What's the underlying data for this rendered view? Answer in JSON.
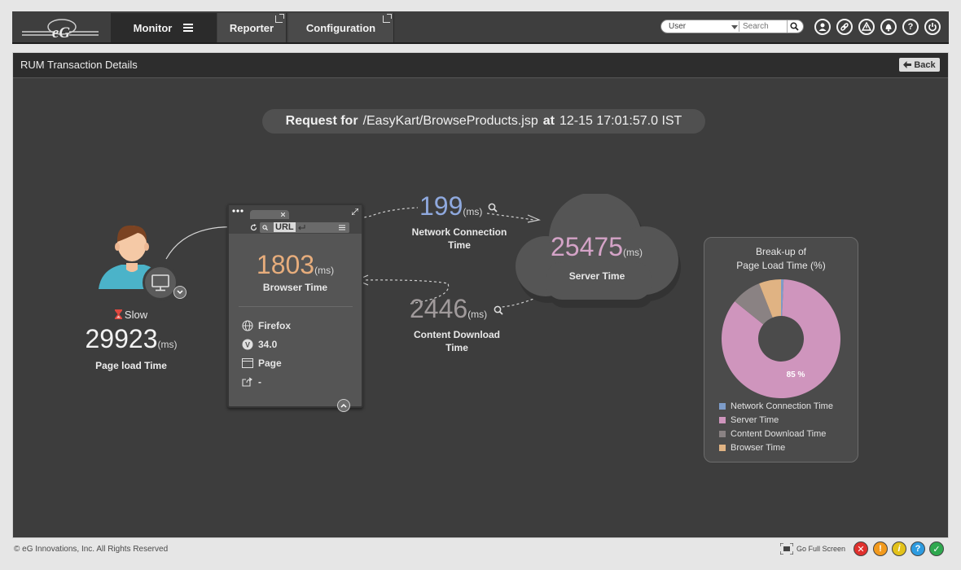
{
  "nav": {
    "logo_text": "eG",
    "tabs": [
      {
        "label": "Monitor"
      },
      {
        "label": "Reporter"
      },
      {
        "label": "Configuration"
      }
    ],
    "user_select": "User",
    "search_placeholder": "Search"
  },
  "panel": {
    "title": "RUM Transaction Details",
    "back_label": "Back"
  },
  "request": {
    "prefix": "Request for",
    "path": "/EasyKart/BrowseProducts.jsp",
    "at": "at",
    "timestamp": "12-15 17:01:57.0 IST"
  },
  "user": {
    "status": "Slow",
    "page_load_value": "29923",
    "unit": "(ms)",
    "page_load_label": "Page load Time"
  },
  "browser": {
    "url_label": "URL",
    "value": "1803",
    "unit": "(ms)",
    "label": "Browser Time",
    "info": [
      {
        "icon": "globe-icon",
        "text": "Firefox"
      },
      {
        "icon": "version-icon",
        "text": "34.0"
      },
      {
        "icon": "page-icon",
        "text": "Page"
      },
      {
        "icon": "share-icon",
        "text": "-"
      }
    ]
  },
  "network": {
    "value": "199",
    "unit": "(ms)",
    "label_line1": "Network Connection",
    "label_line2": "Time"
  },
  "download": {
    "value": "2446",
    "unit": "(ms)",
    "label_line1": "Content Download",
    "label_line2": "Time"
  },
  "server": {
    "value": "25475",
    "unit": "(ms)",
    "label": "Server Time"
  },
  "chart": {
    "title_line1": "Break-up of",
    "title_line2": "Page Load Time (%)",
    "legend": [
      {
        "label": "Network Connection Time",
        "color": "#7d9cc9"
      },
      {
        "label": "Server Time",
        "color": "#cf95bd"
      },
      {
        "label": "Content Download Time",
        "color": "#8a8283"
      },
      {
        "label": "Browser Time",
        "color": "#e0b383"
      }
    ],
    "slice_label": "85 %"
  },
  "chart_data": {
    "type": "pie",
    "categories": [
      "Network Connection Time",
      "Server Time",
      "Content Download Time",
      "Browser Time"
    ],
    "values": [
      0.7,
      85.1,
      8.2,
      6.0
    ],
    "title": "Break-up of Page Load Time (%)",
    "legend": "bottom"
  },
  "footer": {
    "copyright": "© eG Innovations, Inc. All Rights Reserved",
    "fullscreen_label": "Go Full Screen"
  }
}
